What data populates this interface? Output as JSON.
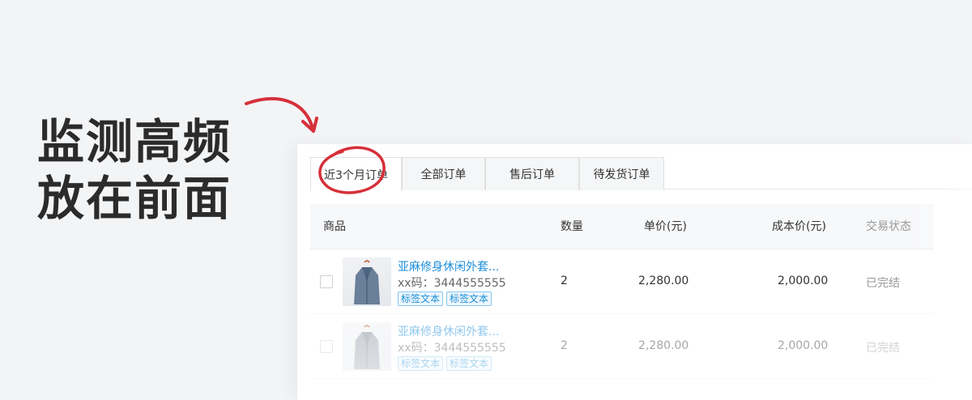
{
  "headline": {
    "line1": "监测高频",
    "line2": "放在前面"
  },
  "tabs": [
    {
      "label": "近3个月订单",
      "active": true
    },
    {
      "label": "全部订单",
      "active": false
    },
    {
      "label": "售后订单",
      "active": false
    },
    {
      "label": "待发货订单",
      "active": false
    }
  ],
  "table": {
    "headers": {
      "product": "商品",
      "qty": "数量",
      "price": "单价(元)",
      "cost": "成本价(元)",
      "status": "交易状态"
    },
    "rows": [
      {
        "name": "亚麻修身休闲外套...",
        "code": "xx码：3444555555",
        "tags": [
          "标签文本",
          "标签文本"
        ],
        "qty": "2",
        "price": "2,280.00",
        "cost": "2,000.00",
        "status": "已完结"
      },
      {
        "name": "亚麻修身休闲外套...",
        "code": "xx码：3444555555",
        "tags": [
          "标签文本",
          "标签文本"
        ],
        "qty": "2",
        "price": "2,280.00",
        "cost": "2,000.00",
        "status": "已完结"
      }
    ]
  },
  "colors": {
    "accent_red": "#d6303a",
    "link_blue": "#1a8ed8"
  },
  "icons": {
    "thumbnail": "jacket-product-image",
    "annotation": "hand-drawn-arrow-and-circle"
  }
}
